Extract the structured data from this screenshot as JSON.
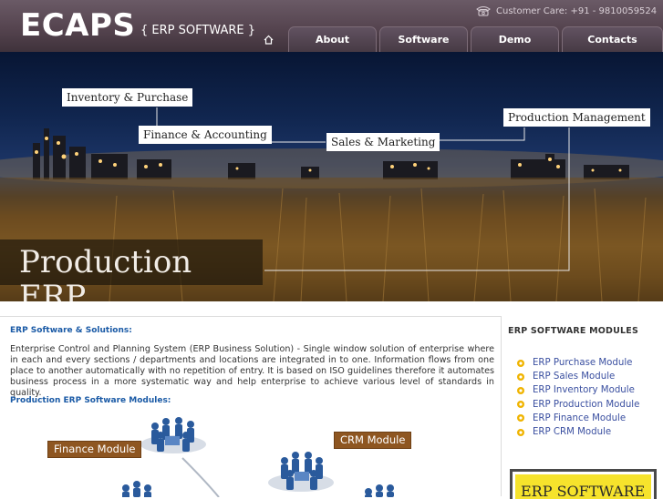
{
  "header": {
    "logo": "ECAPS",
    "tagline": "{ ERP SOFTWARE }",
    "customer_care": "Customer Care: +91 - 9810059524",
    "nav": [
      "About",
      "Software",
      "Demo",
      "Contacts"
    ]
  },
  "banner": {
    "labels": {
      "inventory": "Inventory & Purchase",
      "finance": "Finance & Accounting",
      "sales": "Sales & Marketing",
      "production": "Production Management"
    },
    "title": "Production ERP"
  },
  "main": {
    "intro_heading": "ERP Software & Solutions:",
    "intro_text": "Enterprise Control and Planning System (ERP Business Solution) - Single window solution of enterprise where in each and every sections / departments and locations are integrated in to one. Information flows from one place to another automatically with no repetition of entry. It is based on ISO guidelines therefore it automates business process in a more systematic way and help enterprise to achieve various level of standards in quality.",
    "modules_heading": "Production ERP Software Modules:",
    "diagram_labels": {
      "finance": "Finance Module",
      "crm": "CRM Module"
    }
  },
  "sidebar": {
    "heading": "ERP SOFTWARE MODULES",
    "items": [
      "ERP Purchase Module",
      "ERP Sales Module",
      "ERP Inventory Module",
      "ERP Production Module",
      "ERP Finance Module",
      "ERP CRM Module"
    ],
    "promo": "ERP SOFTWARE"
  },
  "colors": {
    "header_bg": "#55444f",
    "link_blue": "#1a5aa6",
    "module_tag": "#8e5621",
    "bullet": "#f0b400",
    "promo_yellow": "#f6e32c"
  }
}
